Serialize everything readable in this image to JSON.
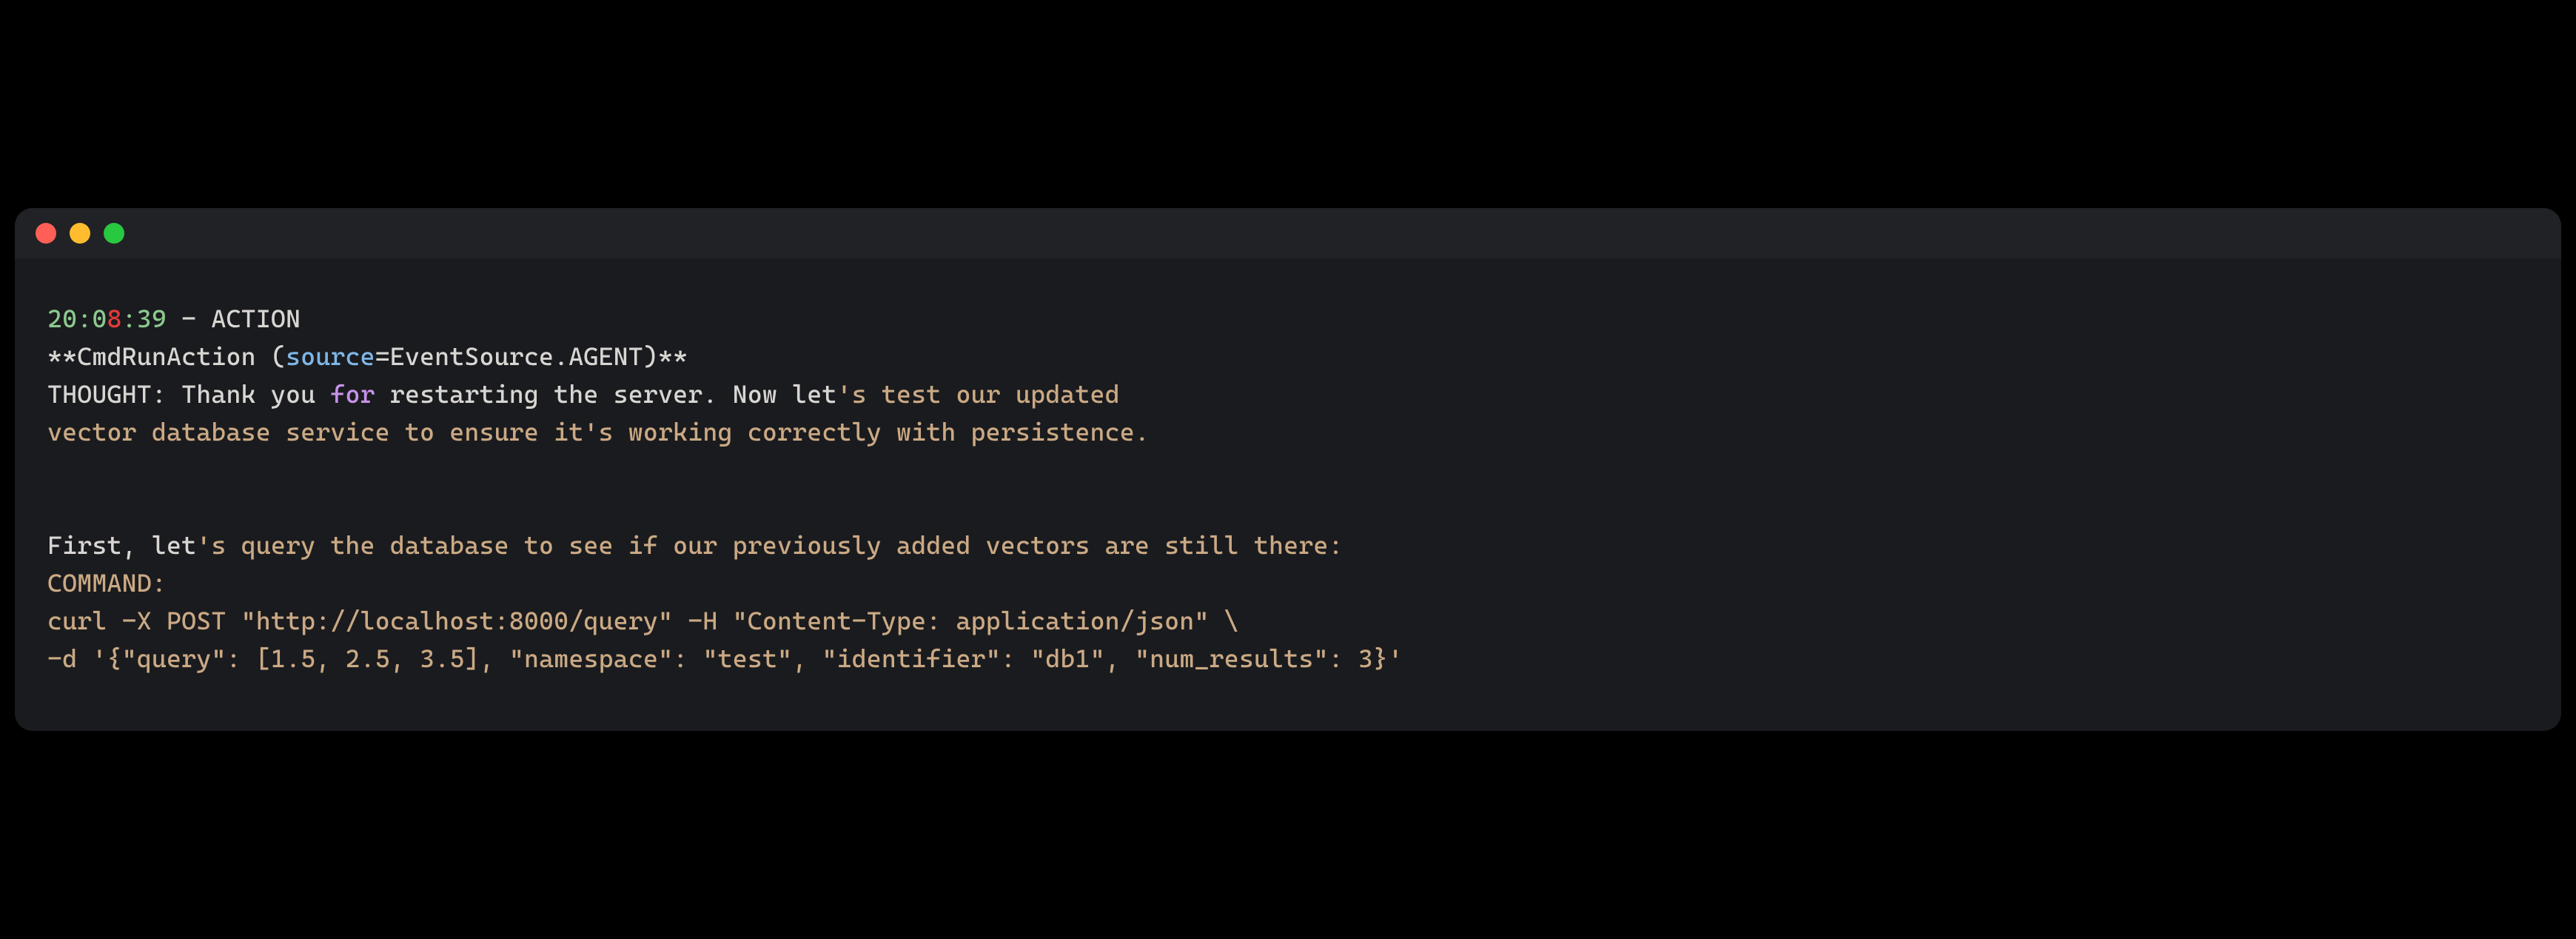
{
  "window": {
    "traffic_lights": [
      "close",
      "minimize",
      "zoom"
    ]
  },
  "log": {
    "timestamp": {
      "h": "20",
      "m1": "0",
      "m2": "8",
      "s": "39"
    },
    "level": "ACTION",
    "action_prefix": "**CmdRunAction (",
    "action_param": "source",
    "action_eq": "=EventSource.AGENT)**",
    "thought_label": "THOUGHT: Thank you ",
    "thought_for": "for",
    "thought_rest1": " restarting the server. Now let",
    "thought_tan1": "'s test our updated",
    "thought_line2a": "vector database service to ensure it",
    "thought_tan2": "'s working correctly with persistence.",
    "first_let": "First, let",
    "first_tan": "'s query the database to see if our previously added vectors are still there:",
    "command_label": "COMMAND:",
    "cmd_l1_a": "curl -X POST ",
    "cmd_l1_url": "\"http://localhost:8000/query\"",
    "cmd_l1_b": " -H ",
    "cmd_l1_ct": "\"Content-Type: application/json\"",
    "cmd_l1_c": " \\",
    "cmd_l2_a": "-d ",
    "cmd_l2_open": "'{\"query\"",
    "cmd_l2_colon1": ": [",
    "cmd_l2_n1": "1.5",
    "cmd_l2_c1": ", ",
    "cmd_l2_n2": "2.5",
    "cmd_l2_c2": ", ",
    "cmd_l2_n3": "3.5",
    "cmd_l2_close_arr": "], ",
    "cmd_l2_ns": "\"namespace\"",
    "cmd_l2_colon2": ": ",
    "cmd_l2_ns_v": "\"test\"",
    "cmd_l2_c3": ", ",
    "cmd_l2_id": "\"identifier\"",
    "cmd_l2_colon3": ": ",
    "cmd_l2_id_v": "\"db1\"",
    "cmd_l2_c4": ", ",
    "cmd_l2_nr": "\"num_results\"",
    "cmd_l2_colon4": ": ",
    "cmd_l2_nr_v": "3",
    "cmd_l2_end": "}'"
  }
}
